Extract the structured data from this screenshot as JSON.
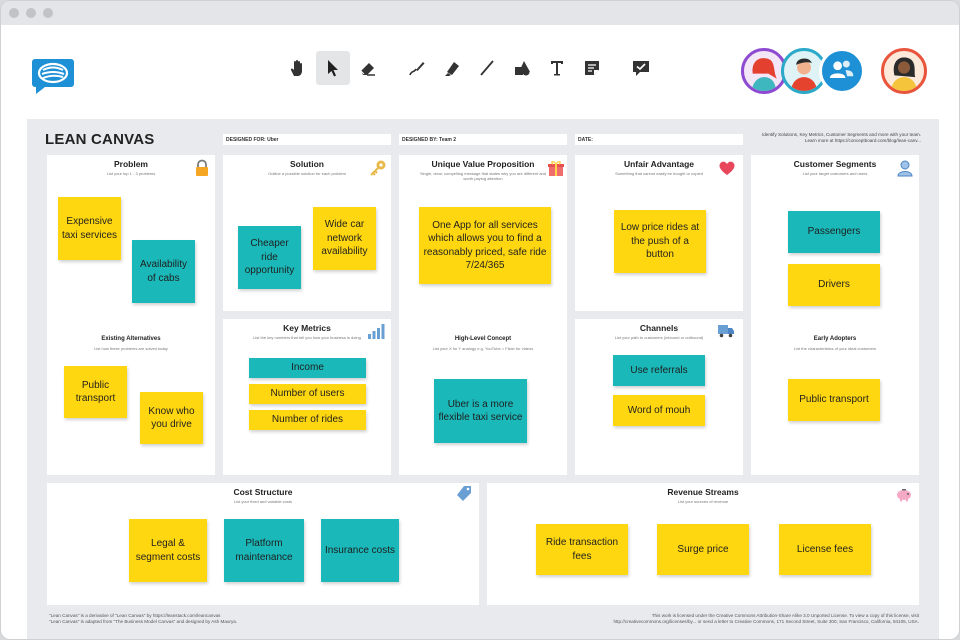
{
  "toolbar": {
    "tools": [
      "hand-tool",
      "select-tool",
      "eraser-tool",
      "pen-tool",
      "highlighter-tool",
      "line-tool",
      "shape-tool",
      "text-tool",
      "sticky-note-tool",
      "comment-tool"
    ]
  },
  "canvas": {
    "title": "LEAN CANVAS",
    "designed_for": "DESIGNED FOR: Uber",
    "designed_by": "DESIGNED BY: Team 2",
    "date": "DATE:",
    "note_line1": "Identify Solutions, Key Metrics, Customer Segments and more with your team.",
    "note_line2": "Learn more at https://conceptboard.com/blog/lean-canv..."
  },
  "panels": {
    "problem": {
      "title": "Problem",
      "sub": "List your top 1 - 3 problems",
      "sub2_title": "Existing Alternatives",
      "sub2_desc": "List how these problems are solved today"
    },
    "solution": {
      "title": "Solution",
      "sub": "Outline a possible solution for each problem"
    },
    "key_metrics": {
      "title": "Key Metrics",
      "sub": "List the key numbers that tell you how your business is doing"
    },
    "uvp": {
      "title": "Unique Value Proposition",
      "sub": "Single, clear, compelling message that states why you are different and worth paying attention",
      "sub2_title": "High-Level Concept",
      "sub2_desc": "List your X for Y analogy e.g. YouTube = Flickr for videos"
    },
    "unfair": {
      "title": "Unfair Advantage",
      "sub": "Something that cannot easily be bought or copied"
    },
    "channels": {
      "title": "Channels",
      "sub": "List your path to customers (inbound or outbound)"
    },
    "segments": {
      "title": "Customer Segments",
      "sub": "List your target customers and users",
      "sub2_title": "Early Adopters",
      "sub2_desc": "List the characteristics of your ideal customers"
    },
    "cost": {
      "title": "Cost Structure",
      "sub": "List your fixed and variable costs"
    },
    "revenue": {
      "title": "Revenue Streams",
      "sub": "List your sources of revenue"
    }
  },
  "notes": {
    "expensive_taxi": "Expensive taxi services",
    "availability": "Availability of cabs",
    "public_transport": "Public transport",
    "know_who": "Know who you drive",
    "cheaper_ride": "Cheaper ride opportunity",
    "wide_car": "Wide car network availability",
    "income": "Income",
    "num_users": "Number of users",
    "num_rides": "Number of rides",
    "one_app": "One App for all services which allows you to find a reasonably priced, safe ride 7/24/365",
    "uber_concept": "Uber is a more flexible taxi service",
    "low_price": "Low price rides at the push of a button",
    "use_referrals": "Use referrals",
    "word_of_mouth": "Word of mouh",
    "passengers": "Passengers",
    "drivers": "Drivers",
    "public_transport_2": "Public transport",
    "legal_costs": "Legal & segment costs",
    "platform": "Platform maintenance",
    "insurance": "Insurance costs",
    "ride_fees": "Ride transaction fees",
    "surge": "Surge price",
    "license": "License fees"
  },
  "footer": {
    "left1": "\"Lean Canvas\" is a derivative of \"Lean Canvas\" by https://leanstack.com/leancanvas",
    "left2": "\"Lean Canvas\" is adapted from \"The Business Model Canvas\" and designed by Ash Maurya.",
    "right1": "This work is licensed under the Creative Commons Attribution-Share Alike 3.0 Unported License. To view a copy of this license, visit",
    "right2": "http://creativecommons.org/licenses/by... or send a letter to Creative Commons, 171 Second Street, Suite 300, San Francisco, California, 94105, USA."
  },
  "colors": {
    "yellow": "#ffd710",
    "teal": "#1ab8b9",
    "brand": "#1e90d6"
  }
}
